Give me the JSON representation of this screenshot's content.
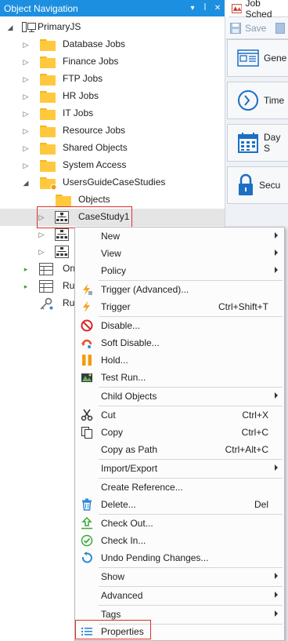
{
  "left_pane": {
    "title": "Object Navigation",
    "root": {
      "label": "PrimaryJS"
    },
    "folders": [
      {
        "label": "Database Jobs"
      },
      {
        "label": "Finance Jobs"
      },
      {
        "label": "FTP Jobs"
      },
      {
        "label": "HR Jobs"
      },
      {
        "label": "IT Jobs"
      },
      {
        "label": "Resource Jobs"
      },
      {
        "label": "Shared Objects"
      },
      {
        "label": "System Access"
      },
      {
        "label": "UsersGuideCaseStudies"
      },
      {
        "label": "Objects"
      }
    ],
    "selected_item": {
      "label": "CaseStudy1"
    },
    "partial_rows": [
      {
        "label": "On"
      },
      {
        "label": "Ru"
      },
      {
        "label": "Ru"
      }
    ]
  },
  "right_pane": {
    "tab_label": "Job Sched",
    "toolbar": {
      "save_label": "Save"
    },
    "buttons": [
      {
        "label": "Gene"
      },
      {
        "label": "Time"
      },
      {
        "label": "Day S"
      },
      {
        "label": "Secu"
      }
    ]
  },
  "context_menu": {
    "items": [
      {
        "label": "New",
        "shortcut": ""
      },
      {
        "label": "View",
        "shortcut": ""
      },
      {
        "label": "Policy",
        "shortcut": ""
      },
      {
        "label": "Trigger (Advanced)...",
        "shortcut": ""
      },
      {
        "label": "Trigger",
        "shortcut": "Ctrl+Shift+T"
      },
      {
        "label": "Disable...",
        "shortcut": ""
      },
      {
        "label": "Soft Disable...",
        "shortcut": ""
      },
      {
        "label": "Hold...",
        "shortcut": ""
      },
      {
        "label": "Test Run...",
        "shortcut": ""
      },
      {
        "label": "Child Objects",
        "shortcut": ""
      },
      {
        "label": "Cut",
        "shortcut": "Ctrl+X"
      },
      {
        "label": "Copy",
        "shortcut": "Ctrl+C"
      },
      {
        "label": "Copy as Path",
        "shortcut": "Ctrl+Alt+C"
      },
      {
        "label": "Import/Export",
        "shortcut": ""
      },
      {
        "label": "Create Reference...",
        "shortcut": ""
      },
      {
        "label": "Delete...",
        "shortcut": "Del"
      },
      {
        "label": "Check Out...",
        "shortcut": ""
      },
      {
        "label": "Check In...",
        "shortcut": ""
      },
      {
        "label": "Undo Pending Changes...",
        "shortcut": ""
      },
      {
        "label": "Show",
        "shortcut": ""
      },
      {
        "label": "Advanced",
        "shortcut": ""
      },
      {
        "label": "Tags",
        "shortcut": ""
      },
      {
        "label": "Properties",
        "shortcut": ""
      }
    ]
  },
  "colors": {
    "header_blue": "#1c8fe0",
    "folder_yellow": "#ffc83d",
    "highlight_red": "#d9302c",
    "trigger_orange": "#f5a623",
    "disable_red": "#d7262d",
    "hold_orange": "#f29b13",
    "delete_blue": "#2b8ad8",
    "check_green": "#3aa83a"
  }
}
